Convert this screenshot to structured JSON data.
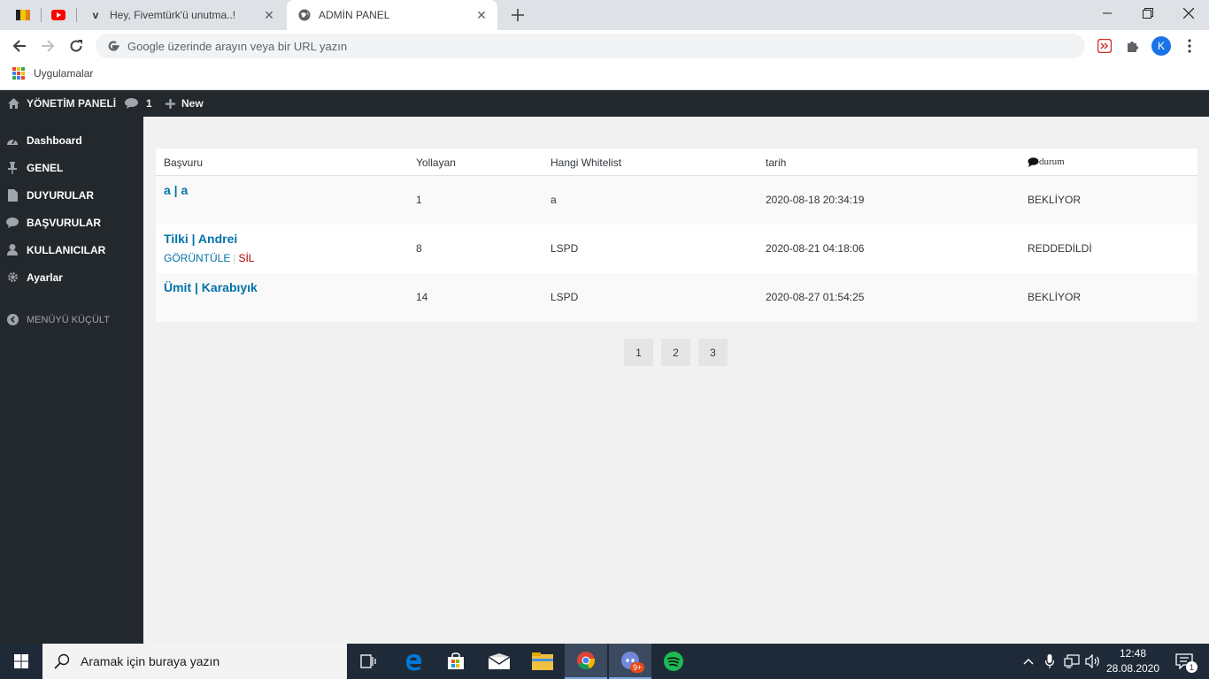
{
  "browser": {
    "tabs": [
      {
        "title": "Hey, Fivemtürk'ü unutma..!"
      },
      {
        "title": "ADMİN PANEL"
      }
    ],
    "omnibox_placeholder": "Google üzerinde arayın veya bir URL yazın",
    "bookmarks": [
      {
        "label": "Uygulamalar"
      }
    ],
    "profile_initial": "K"
  },
  "adminbar": {
    "site_name": "YÖNETİM PANELİ",
    "comments_count": "1",
    "new_label": "New"
  },
  "sidebar": {
    "items": [
      {
        "label": "Dashboard",
        "icon": "dashboard-icon"
      },
      {
        "label": "GENEL",
        "icon": "pin-icon"
      },
      {
        "label": "DUYURULAR",
        "icon": "page-icon"
      },
      {
        "label": "BAŞVURULAR",
        "icon": "comment-icon"
      },
      {
        "label": "KULLANICILAR",
        "icon": "user-icon"
      },
      {
        "label": "Ayarlar",
        "icon": "gear-icon"
      }
    ],
    "collapse_label": "MENÜYÜ KÜÇÜLT"
  },
  "table": {
    "columns": [
      "Başvuru",
      "Yollayan",
      "Hangi Whitelist",
      "tarih",
      "durum"
    ],
    "rows": [
      {
        "title": "a | a",
        "sender": "1",
        "whitelist": "a",
        "date": "2020-08-18 20:34:19",
        "status": "BEKLİYOR"
      },
      {
        "title": "Tilki | Andrei",
        "sender": "8",
        "whitelist": "LSPD",
        "date": "2020-08-21 04:18:06",
        "status": "REDDEDİLDİ",
        "actions": {
          "view": "GÖRÜNTÜLE",
          "delete": "SİL"
        }
      },
      {
        "title": "Ümit | Karabıyık",
        "sender": "14",
        "whitelist": "LSPD",
        "date": "2020-08-27 01:54:25",
        "status": "BEKLİYOR"
      }
    ]
  },
  "pagination": [
    "1",
    "2",
    "3"
  ],
  "taskbar": {
    "search_placeholder": "Aramak için buraya yazın",
    "time": "12:48",
    "date": "28.08.2020",
    "notification_count": "1",
    "discord_badge": "9+"
  },
  "colors": {
    "admin_dark": "#23282d",
    "link": "#0073aa",
    "delete": "#a00000",
    "taskbar": "#1f2a38"
  }
}
